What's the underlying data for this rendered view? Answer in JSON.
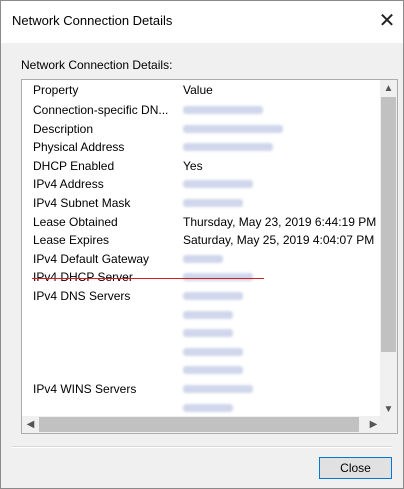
{
  "window": {
    "title": "Network Connection Details",
    "group_label": "Network Connection Details:",
    "close_glyph": "✕",
    "close_button_label": "Close"
  },
  "table": {
    "headers": {
      "property": "Property",
      "value": "Value"
    },
    "rows": [
      {
        "property": "Connection-specific DN...",
        "value": "",
        "redacted": true
      },
      {
        "property": "Description",
        "value": "",
        "redacted": true
      },
      {
        "property": "Physical Address",
        "value": "",
        "redacted": true
      },
      {
        "property": "DHCP Enabled",
        "value": "Yes",
        "redacted": false
      },
      {
        "property": "IPv4 Address",
        "value": "",
        "redacted": true,
        "underlined": true
      },
      {
        "property": "IPv4 Subnet Mask",
        "value": "",
        "redacted": true
      },
      {
        "property": "Lease Obtained",
        "value": "Thursday, May 23, 2019 6:44:19 PM",
        "redacted": false
      },
      {
        "property": "Lease Expires",
        "value": "Saturday, May 25, 2019 4:04:07 PM",
        "redacted": false
      },
      {
        "property": "IPv4 Default Gateway",
        "value": "",
        "redacted": true
      },
      {
        "property": "IPv4 DHCP Server",
        "value": "",
        "redacted": true
      },
      {
        "property": "IPv4 DNS Servers",
        "value": "",
        "redacted": true
      },
      {
        "property": "",
        "value": "",
        "redacted": true
      },
      {
        "property": "",
        "value": "",
        "redacted": true
      },
      {
        "property": "",
        "value": "",
        "redacted": true
      },
      {
        "property": "",
        "value": "",
        "redacted": true
      },
      {
        "property": "IPv4 WINS Servers",
        "value": "",
        "redacted": true
      },
      {
        "property": "",
        "value": "",
        "redacted": true
      },
      {
        "property": "",
        "value": "",
        "redacted": true
      }
    ]
  },
  "scrollbars": {
    "up_arrow": "▲",
    "down_arrow": "▼",
    "left_arrow": "◀",
    "right_arrow": "▶"
  }
}
